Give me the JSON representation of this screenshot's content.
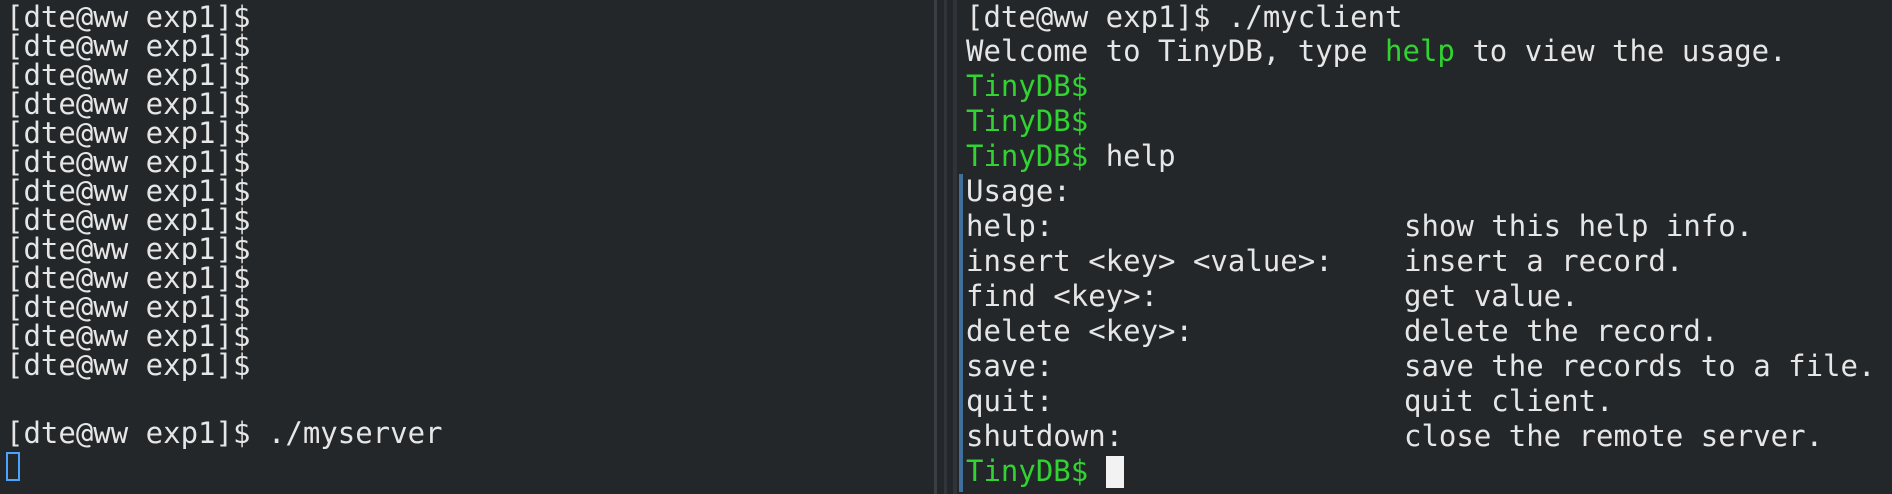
{
  "left_terminal": {
    "prompt": "[dte@ww exp1]$",
    "empty_prompt_lines": 13,
    "last_command": "./myserver"
  },
  "right_terminal": {
    "shell_prompt": "[dte@ww exp1]$",
    "shell_command": "./myclient",
    "welcome": {
      "before": "Welcome to TinyDB, type ",
      "highlight": "help",
      "after": " to view the usage."
    },
    "tinydb_prompt": "TinyDB$",
    "help_command": "help",
    "usage_title": "Usage:",
    "usage": [
      {
        "command": "help:",
        "description": "show this help info."
      },
      {
        "command": "insert <key> <value>:",
        "description": "insert a record."
      },
      {
        "command": "find <key>:",
        "description": "get value."
      },
      {
        "command": "delete <key>:",
        "description": "delete the record."
      },
      {
        "command": "save:",
        "description": "save the records to a file."
      },
      {
        "command": "quit:",
        "description": "quit client."
      },
      {
        "command": "shutdown:",
        "description": "close the remote server."
      }
    ]
  },
  "colors": {
    "background": "#23272a",
    "text": "#e6e6e6",
    "prompt_green": "#32d232",
    "focus_bar": "#3f6f9a",
    "cursor_outline": "#4aa3ff"
  }
}
